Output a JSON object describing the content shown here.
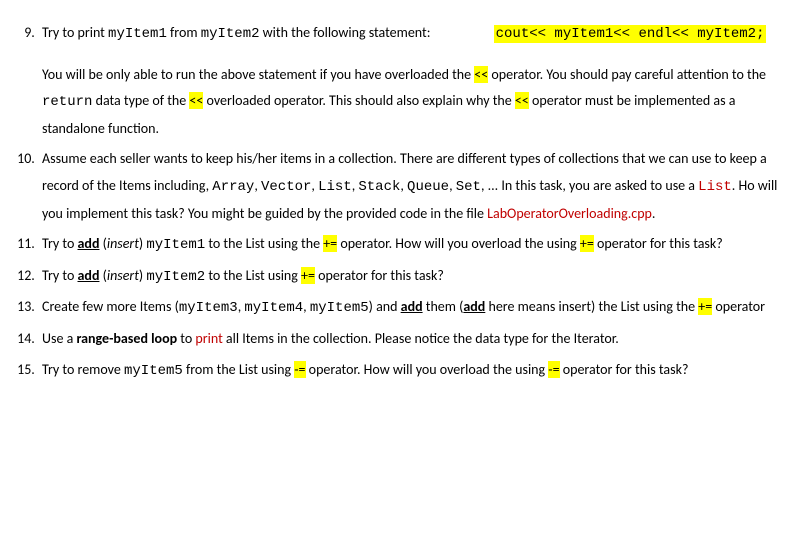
{
  "q9": {
    "lead_a": "Try to print ",
    "myItem1": "myItem1",
    "lead_b": " from ",
    "myItem2": "myItem2",
    "lead_c": " with the following statement:",
    "stmt": "cout<< myItem1<< endl<< myItem2;",
    "p_a": "You will be only able to run the above statement if you have overloaded the ",
    "op1": "<<",
    "p_b": " operator. You should pay careful attention to the ",
    "ret": "return",
    "p_c": " data type of the ",
    "op2": "<<",
    "p_d": " overloaded operator. This should also explain why the ",
    "op3": "<<",
    "p_e": " operator must be implemented as a standalone function."
  },
  "q10": {
    "a": "Assume each seller wants to keep his/her items in a collection. There are different types of collections that we can use to keep a record of the Items including, ",
    "arr": "Array",
    "c1": ", ",
    "vec": "Vector",
    "c2": ", ",
    "lst": "List",
    "c3": ", ",
    "stk": "Stack",
    "c4": ", ",
    "que": "Queue",
    "c5": ", ",
    "set": "Set",
    "b": ", ... In this task, you are asked to use a ",
    "listred": "List",
    "c": ". Ho will you implement this task? You might be guided by the provided code in the file ",
    "file": "LabOperatorOverloading.cpp",
    "d": "."
  },
  "q11": {
    "a": "Try to ",
    "add": "add",
    "b": " (",
    "ins": "insert",
    "c": ") ",
    "item": "myItem1",
    "d": "  to the List using the ",
    "op1": "+=",
    "e": " operator.  How will you overload the using ",
    "op2": "+=",
    "f": " operator for this task?"
  },
  "q12": {
    "a": "Try to ",
    "add": "add",
    "b": " (",
    "ins": "insert",
    "c": ") ",
    "item": "myItem2",
    "d": "  to the List using ",
    "op1": "+=",
    "e": " operator for this task?"
  },
  "q13": {
    "a": "Create few more Items (",
    "i3": "myItem3",
    "c1": ",  ",
    "i4": "myItem4",
    "c2": ",  ",
    "i5": "myItem5",
    "b": ") and ",
    "add1": "add",
    "c": " them (",
    "add2": "add",
    "d": " here means insert) the List using the ",
    "op": "+=",
    "e": " operator"
  },
  "q14": {
    "a": "Use a ",
    "loop": "range-based loop",
    "b": " to ",
    "print": "print",
    "c": " all Items in the collection. Please notice the data type for the Iterator."
  },
  "q15": {
    "a": "Try to remove ",
    "item": "myItem5",
    "b": "  from the List using ",
    "op1": "-=",
    "c": " operator.  How will you overload the using ",
    "op2": "-=",
    "d": " operator for this task?"
  }
}
